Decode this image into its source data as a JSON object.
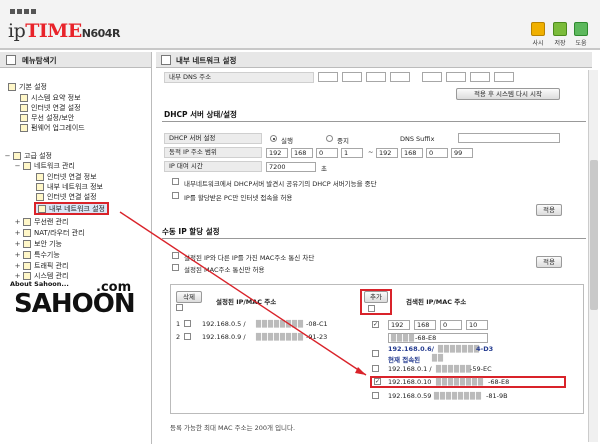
{
  "header": {
    "brand_prefix": "ip",
    "brand_name": "TIME",
    "model": "N604R",
    "toolbar": [
      {
        "label": "사시",
        "color": "#e8a500",
        "icon": "home-icon"
      },
      {
        "label": "저장",
        "color": "#6da935",
        "icon": "save-icon"
      },
      {
        "label": "도움",
        "color": "#4ba84b",
        "icon": "help-icon"
      }
    ]
  },
  "left": {
    "title": "메뉴탐색기",
    "tree": [
      {
        "label": "기본 설정",
        "level": 0
      },
      {
        "label": "시스템 요약 정보",
        "level": 1
      },
      {
        "label": "인터넷 연결 설정",
        "level": 1
      },
      {
        "label": "무선 설정/보안",
        "level": 1
      },
      {
        "label": "펌웨어 업그레이드",
        "level": 1
      },
      {
        "label": "고급 설정",
        "level": 0
      },
      {
        "label": "네트워크 관리",
        "level": 1
      },
      {
        "label": "인터넷 연결 정보",
        "level": 2
      },
      {
        "label": "내부 네트워크 정보",
        "level": 2
      },
      {
        "label": "인터넷 연결 설정",
        "level": 2
      },
      {
        "label": "내부 네트워크 설정",
        "level": 2,
        "selected": true
      },
      {
        "label": "무선랜 관리",
        "level": 1
      },
      {
        "label": "NAT/라우터 관리",
        "level": 1
      },
      {
        "label": "보안 기능",
        "level": 1
      },
      {
        "label": "특수기능",
        "level": 1
      },
      {
        "label": "트래픽 관리",
        "level": 1
      },
      {
        "label": "시스템 관리",
        "level": 1
      }
    ],
    "watermark": {
      "small": "About Sahoon...",
      "big": "SAHOON",
      "com": ".com"
    }
  },
  "right": {
    "title": "내부 네트워크 설정",
    "dns_label": "내부 DNS 주소",
    "apply_restart": "적용 후 시스템 다시 시작",
    "dhcp": {
      "section": "DHCP 서버 상태/설정",
      "server_label": "DHCP 서버 설정",
      "run": "실행",
      "stop": "중지",
      "dns_suffix": "DNS Suffix",
      "range_label": "동적 IP 주소 범위",
      "range_start": [
        "192",
        "168",
        "0",
        "1"
      ],
      "range_sep": "~",
      "range_end": [
        "192",
        "168",
        "0",
        "99"
      ],
      "lease_label": "IP 대여 시간",
      "lease_value": "7200",
      "lease_unit": "초",
      "opt1": "내부네트워크에서 DHCP서버 발견시 공유기의 DHCP 서버기능을 중단",
      "opt2": "IP를 할당받은 PC만 인터넷 접속을 허용",
      "apply": "적용"
    },
    "manual": {
      "section": "수동 IP 할당 설정",
      "opt1": "설정된 IP와 다른 IP를 가진 MAC주소 통신 차단",
      "opt2": "설정된 MAC주소 통신만 허용",
      "apply": "적용",
      "delete": "삭제",
      "add": "추가",
      "left_header": "설정된 IP/MAC 주소",
      "right_header": "검색된 IP/MAC 주소",
      "left_rows": [
        {
          "num": "1",
          "ip": "192.168.0.5 / ",
          "mac_tail": "-08-C1"
        },
        {
          "num": "2",
          "ip": "192.168.0.9 / ",
          "mac_tail": "-91-23"
        }
      ],
      "entry": {
        "ip": [
          "192",
          "168",
          "0",
          "10"
        ],
        "mac_tail": "-68-E8"
      },
      "right_rows": [
        {
          "text": "192.168.0.6/",
          "mac_tail": "4-D3",
          "bold": true
        },
        {
          "text": "현재 접속된",
          "mac_tail": "",
          "bold": true
        },
        {
          "text": "192.168.0.1 / ",
          "mac_tail": "-59-EC",
          "bold": false
        },
        {
          "text": "192.168.0.10 ",
          "mac_tail": "-68-E8",
          "bold": false,
          "checked": true
        },
        {
          "text": "192.168.0.59",
          "mac_tail": "-81-9B",
          "bold": false
        }
      ],
      "footer": "등록 가능한 최대 MAC 주소는 200개 입니다."
    }
  },
  "colors": {
    "accent": "#d9232a",
    "link": "#233a8f"
  }
}
